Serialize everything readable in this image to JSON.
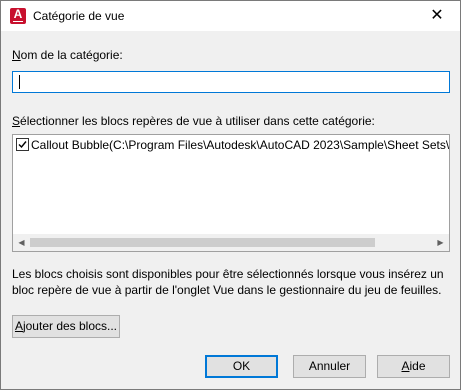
{
  "window": {
    "title": "Catégorie de vue",
    "icon": "autocad-app-icon",
    "icon_glyph": "A",
    "close_glyph": "✕",
    "accent_color": "#0078d7",
    "brand_color": "#c8102e"
  },
  "name_field": {
    "label_mnemonic": "N",
    "label_rest": "om de la catégorie:",
    "value": ""
  },
  "list_section": {
    "label_mnemonic": "S",
    "label_rest": "électionner les blocs repères de vue à utiliser dans cette catégorie:",
    "items": [
      {
        "checked": true,
        "text": "Callout Bubble(C:\\Program Files\\Autodesk\\AutoCAD 2023\\Sample\\Sheet Sets\\Architectu"
      }
    ],
    "scroll_left_glyph": "◀",
    "scroll_right_glyph": "▶"
  },
  "info_text": "Les blocs choisis sont disponibles pour être sélectionnés lorsque vous insérez un bloc repère de vue à partir de l'onglet Vue dans le gestionnaire du jeu de feuilles.",
  "buttons": {
    "add_blocks_mnemonic": "A",
    "add_blocks_rest": "jouter des blocs...",
    "ok": "OK",
    "cancel": "Annuler",
    "help_mnemonic": "A",
    "help_rest": "ide"
  }
}
